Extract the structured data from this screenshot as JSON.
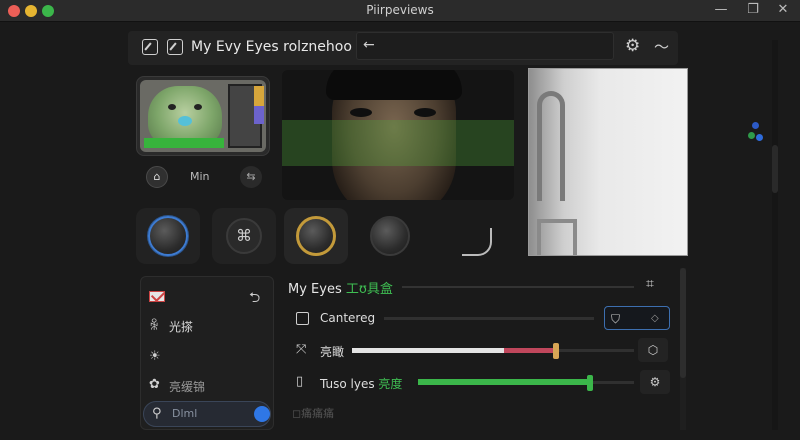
{
  "window": {
    "title": "Piirpeviews",
    "controls": {
      "minimize": "—",
      "maximize": "❐",
      "close": "✕"
    }
  },
  "toolbar": {
    "title": "My Evy Eyes rolznehoo",
    "search_placeholder": "",
    "back_glyph": "←",
    "gear_glyph": "⚙",
    "wave_glyph": "〜"
  },
  "thumbnail": {
    "control_label": "Min",
    "home_glyph": "⌂",
    "swap_glyph": "⇆"
  },
  "dials": {
    "dial2_glyph": "⌘"
  },
  "sidebar": {
    "return_glyph": "⮌",
    "items": [
      {
        "icon": "ꆜ",
        "label": "光搽"
      },
      {
        "icon": "☀",
        "label": ""
      },
      {
        "icon": "✿",
        "label": "亮缓锦"
      }
    ],
    "active": {
      "icon": "⚲",
      "label": "Dlml"
    }
  },
  "panel": {
    "title_en": "My Eyes",
    "title_cn": "工ʊ具盒",
    "title_icon": "⌗",
    "rows": [
      {
        "label": "Cantereg",
        "btn_main": "⛉",
        "btn_side": "◇"
      },
      {
        "icon": "⤧",
        "label": "亮瞰",
        "btn": "⬡",
        "value_white": 0.54,
        "value_red": 0.18
      },
      {
        "icon": "▯",
        "label_en": "Tuso lyes",
        "label_cn": "亮度",
        "btn": "⚙",
        "value": 0.79
      }
    ]
  },
  "footer": {
    "faint_text": "◻痛痛痛"
  },
  "colors": {
    "accent_green": "#3bb64a",
    "accent_blue": "#2f77e6",
    "slider_red": "#c0475c",
    "thumb_amber": "#d8a655"
  }
}
